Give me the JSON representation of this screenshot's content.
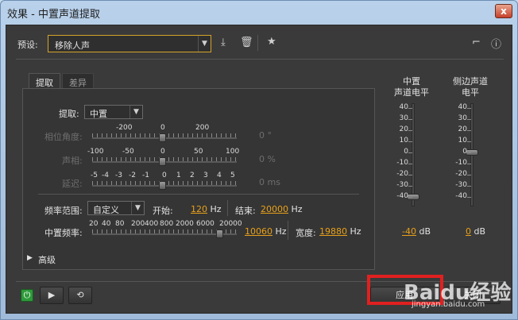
{
  "window": {
    "title": "效果 - 中置声道提取",
    "close_glyph": "x"
  },
  "preset": {
    "label": "预设:",
    "value": "移除人声"
  },
  "tabs": [
    {
      "label": "提取"
    },
    {
      "label": "差异"
    }
  ],
  "extract": {
    "label": "提取:",
    "value": "中置"
  },
  "phase": {
    "label": "相位角度:",
    "scale": [
      "-200",
      "0",
      "200"
    ],
    "value": "0",
    "unit": "°"
  },
  "pan": {
    "label": "声相:",
    "scale": [
      "-100",
      "-50",
      "0",
      "50",
      "100"
    ],
    "value": "0",
    "unit": "%"
  },
  "delay": {
    "label": "延迟:",
    "scale": [
      "-5",
      "-4",
      "-3",
      "-2",
      "-1",
      "0",
      "1",
      "2",
      "3",
      "4",
      "5"
    ],
    "value": "0",
    "unit": "ms"
  },
  "freq": {
    "range_label": "频率范围:",
    "range_value": "自定义",
    "start_label": "开始:",
    "start_value": "120",
    "start_unit": "Hz",
    "end_label": "结束:",
    "end_value": "20000",
    "end_unit": "Hz"
  },
  "center_freq": {
    "label": "中置频率:",
    "scale": [
      "20",
      "40",
      "80",
      "200",
      "400",
      "800",
      "2000",
      "6000",
      "20000"
    ],
    "value": "10060",
    "unit": "Hz",
    "slider_fraction": 0.88
  },
  "width": {
    "label": "宽度:",
    "value": "19880",
    "unit": "Hz"
  },
  "meters": {
    "center": {
      "title_line1": "中置",
      "title_line2": "声道电平",
      "value": "-40",
      "unit": "dB",
      "level_db": -40
    },
    "side": {
      "title_line1": "侧边声道",
      "title_line2": "电平",
      "value": "0",
      "unit": "dB",
      "level_db": 0
    },
    "scale": [
      "40",
      "30",
      "20",
      "10",
      "0",
      "-10",
      "-20",
      "-30",
      "-40"
    ]
  },
  "advanced": {
    "label": "高级"
  },
  "buttons": {
    "apply": "应用",
    "close": "关闭"
  },
  "watermark": {
    "text": "Baidu经验",
    "sub": "jingyan.baidu.com"
  }
}
